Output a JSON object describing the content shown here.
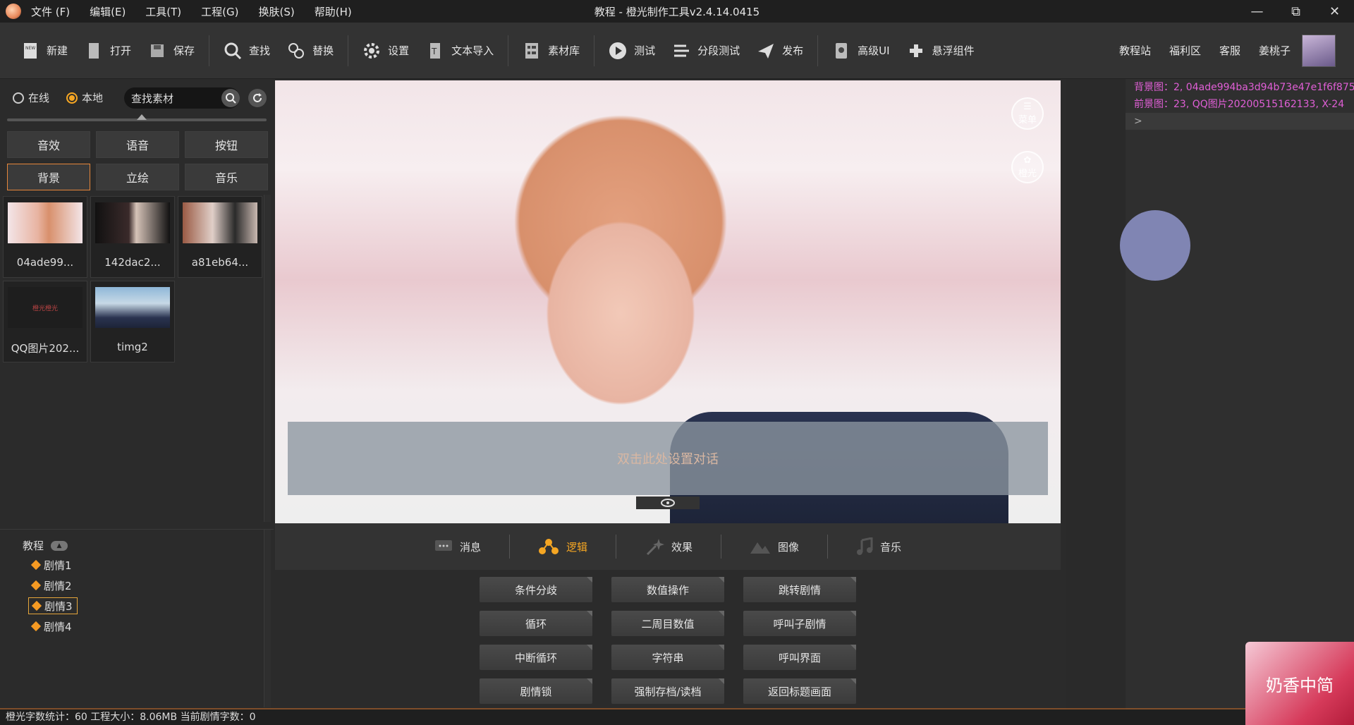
{
  "titlebar": {
    "menus": [
      "文件 (F)",
      "编辑(E)",
      "工具(T)",
      "工程(G)",
      "换肤(S)",
      "帮助(H)"
    ],
    "title": "教程 - 橙光制作工具v2.4.14.0415"
  },
  "toolbar": {
    "buttons": [
      {
        "label": "新建",
        "icon": "new-file-icon"
      },
      {
        "label": "打开",
        "icon": "open-icon"
      },
      {
        "label": "保存",
        "icon": "save-icon"
      },
      {
        "label": "查找",
        "icon": "search-icon"
      },
      {
        "label": "替换",
        "icon": "replace-icon"
      },
      {
        "label": "设置",
        "icon": "gear-icon"
      },
      {
        "label": "文本导入",
        "icon": "text-import-icon"
      },
      {
        "label": "素材库",
        "icon": "library-icon"
      },
      {
        "label": "测试",
        "icon": "play-icon"
      },
      {
        "label": "分段测试",
        "icon": "segment-test-icon"
      },
      {
        "label": "发布",
        "icon": "publish-icon"
      },
      {
        "label": "高级UI",
        "icon": "advanced-ui-icon"
      },
      {
        "label": "悬浮组件",
        "icon": "float-component-icon"
      }
    ],
    "links": [
      "教程站",
      "福利区",
      "客服",
      "姜桃子"
    ]
  },
  "left": {
    "radio_online": "在线",
    "radio_local": "本地",
    "search_placeholder": "查找素材",
    "categories": [
      "音效",
      "语音",
      "按钮",
      "背景",
      "立绘",
      "音乐"
    ],
    "active_category": "背景",
    "thumbnails": [
      "04ade99...",
      "142dac2...",
      "a81eb64...",
      "QQ图片202...",
      "timg2"
    ],
    "thumb_text_qq": "橙光橙光"
  },
  "tree": {
    "root": "教程",
    "items": [
      "剧情1",
      "剧情2",
      "剧情3",
      "剧情4"
    ],
    "selected": "剧情3"
  },
  "stage": {
    "menu_label": "菜单",
    "orange_label": "橙光",
    "dialog_text": "双击此处设置对话"
  },
  "tabs": [
    {
      "label": "消息",
      "icon": "message-icon"
    },
    {
      "label": "逻辑",
      "icon": "logic-icon"
    },
    {
      "label": "效果",
      "icon": "effect-icon"
    },
    {
      "label": "图像",
      "icon": "image-icon"
    },
    {
      "label": "音乐",
      "icon": "music-icon"
    }
  ],
  "active_tab": "逻辑",
  "actions": [
    "条件分歧",
    "数值操作",
    "跳转剧情",
    "循环",
    "二周目数值",
    "呼叫子剧情",
    "中断循环",
    "字符串",
    "呼叫界面",
    "剧情锁",
    "强制存档/读档",
    "返回标题画面"
  ],
  "log": {
    "line1": "背景图：2, 04ade994ba3d94b73e47e1f6f875",
    "line2": "前景图：23, QQ图片20200515162133, X-24",
    "prompt": ">"
  },
  "status": "橙光字数统计：60 工程大小：8.06MB 当前剧情字数：0",
  "sticker_text": "奶香中简",
  "colors": {
    "accent": "#f5a623",
    "log_text": "#e05fd6",
    "panel": "#2b2b2b"
  }
}
